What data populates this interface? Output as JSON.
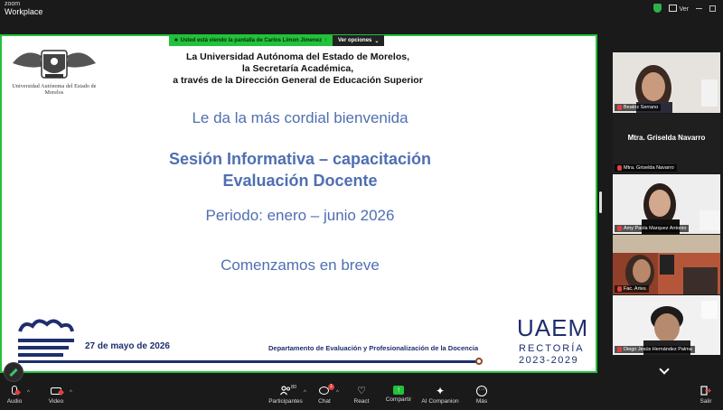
{
  "app": {
    "brand_top": "zoom",
    "brand_bottom": "Workplace",
    "view_label": "Ver"
  },
  "share": {
    "banner_text": "Usted está viendo la pantalla de  Carlos Limon Jimenez",
    "options_label": "Ver opciones"
  },
  "slide": {
    "university": "Universidad Autónoma del Estado de Morelos",
    "header_lines": [
      "La Universidad Autónoma del Estado de Morelos,",
      "la Secretaría Académica,",
      "a través de la Dirección General de Educación Superior"
    ],
    "welcome": "Le da la más cordial bienvenida",
    "title_line1": "Sesión Informativa – capacitación",
    "title_line2": "Evaluación Docente",
    "period": "Periodo: enero – junio 2026",
    "starting": "Comenzamos en breve",
    "date": "27 de mayo de 2026",
    "department": "Departamento de Evaluación y Profesionalización de la Docencia",
    "logo_text": "UAEM",
    "rectoria": "RECTORÍA",
    "years": "2023-2029",
    "colors": {
      "blue": "#4f6fb2",
      "navy": "#1f2e6e"
    }
  },
  "participants": [
    {
      "name": "Beatriz Serrano",
      "mic": "muted"
    },
    {
      "name": "Mtra. Griselda Navarro",
      "display": "Mtra. Griselda Navarro",
      "mic": "muted"
    },
    {
      "name": "Amy Paola Marquez Antonio",
      "mic": "muted"
    },
    {
      "name": "Fac. Artes",
      "mic": "muted"
    },
    {
      "name": "Diego Jesús Hernández Palma",
      "mic": "muted"
    }
  ],
  "toolbar": {
    "audio": "Audio",
    "video": "Video",
    "participants": "Participantes",
    "participants_count": "80",
    "chat": "Chat",
    "chat_badge": "1",
    "react": "React",
    "share": "Compartir",
    "ai": "AI Companion",
    "more": "Más",
    "leave": "Salir"
  },
  "icons": [
    "shield-icon",
    "grid-icon",
    "mic-icon",
    "camera-icon",
    "people-icon",
    "chat-icon",
    "heart-icon",
    "share-screen-icon",
    "ai-sparkle-icon",
    "more-icon",
    "leave-icon",
    "pencil-icon",
    "chevron-down-icon"
  ],
  "accent_green": "#22c23a",
  "muted_red": "#e0413e"
}
